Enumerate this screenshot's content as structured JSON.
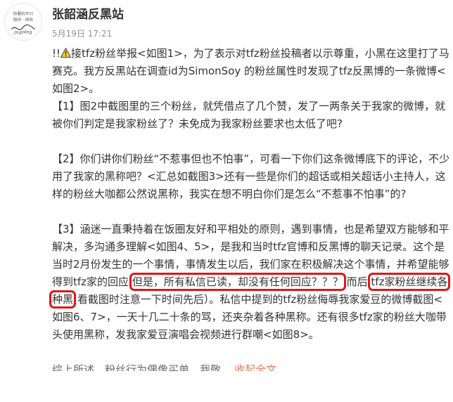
{
  "post": {
    "avatar_text": "jugoleg",
    "author": "张韶涵反黑站",
    "time": "5月19日 17:21",
    "paragraphs": {
      "p1": "!!",
      "p1b": "接tfz粉丝举报<如图1>，为了表示对tfz粉丝投稿者以示尊重，小黑在这里打了马赛克。我方反黑站在调查id为SimonSoy 的粉丝属性时发现了tfz反黑博的一条微博<如图2>。",
      "p2": "【1】图2中截图里的三个粉丝，就凭借点了几个赞，发了一两条关于我家的微博，就被你们判定是我家粉丝了？未免成为我家粉丝要求也太低了吧?",
      "p3": "【2】你们讲你们粉丝“不惹事但也不怕事”，可看一下你们这条微博底下的评论，不少用了我家的黑称吧？<汇总如截图3>还有一些是你们的超话或相关超话小主持人，这样的粉丝大咖都公然说黑称，我实在想不明白你们是怎么“不惹事不怕事”的?",
      "p4a": "【3】涵迷一直秉持着在饭圈友好和平相处的原则，遇到事情，也是希望双方能够和平解决，多沟通多理解<如图4、5>，是我和当时tfz官博和反黑博的聊天记录。这个是当时2月份发生的一个事情，事情发生以后，我们家在积极解决这个事情，并希望能够得到tfz家的回应",
      "p4_hl1": "但是，所有私信已读，却没有任何回应？？？",
      "p4_mid": "而后",
      "p4_hl2": "tfz家粉丝继续各种黑",
      "p4b": "(看截图时注意一下时间先后）。私信中提到的tfz粉丝侮辱我家爱豆的微博截图<如图6、7>，一天十几二十条的骂，还夹杂着各种黑称。还有很多tfz家的粉丝大咖带头使用黑称，发我家爱豆演唱会视频进行群嘲<如图8>。",
      "p5": "综上所述，粉丝行为偶像买单，我敬...",
      "more": "收起全文"
    }
  },
  "colors": {
    "highlight_box": "#e0161a",
    "link": "#eb7350",
    "warning": "#f6c342"
  }
}
